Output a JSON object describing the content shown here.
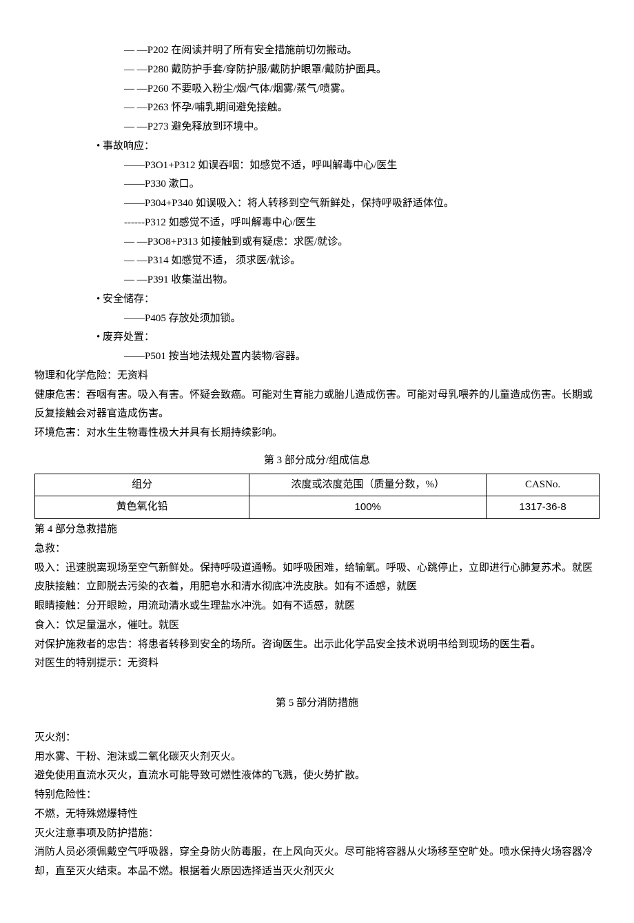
{
  "prevention": [
    "—        —P202 在阅读并明了所有安全措施前切勿搬动。",
    "—        —P280 戴防护手套/穿防护服/戴防护眼罩/戴防护面具。",
    "—        —P260 不要吸入粉尘/烟/气体/烟雾/蒸气/喷雾。",
    "—        —P263 怀孕/哺乳期间避免接触。",
    "—        —P273 避免释放到环境中。"
  ],
  "accident_label": "• 事故响应：",
  "accident": [
    "——P3O1+P312 如误吞咽：如感觉不适，呼叫解毒中心/医生",
    "——P330 漱口。",
    "——P304+P340 如误吸入：将人转移到空气新鲜处，保持呼吸舒适体位。",
    "------P312 如感觉不适，呼叫解毒中心/医生",
    "—        —P3O8+P313 如接触到或有疑虑：求医/就诊。",
    "—        —P314 如感觉不适， 须求医/就诊。",
    "—        —P391 收集溢出物。"
  ],
  "storage_label": "• 安全储存：",
  "storage_item": "——P405 存放处须加锁。",
  "disposal_label": "• 废弃处置：",
  "disposal_item": "——P501 按当地法规处置内装物/容器。",
  "phys_chem": "物理和化学危险：无资料",
  "health": "健康危害：吞咽有害。吸入有害。怀疑会致癌。可能对生育能力或胎儿造成伤害。可能对母乳喂养的儿童造成伤害。长期或反复接触会对器官造成伤害。",
  "env": "环境危害：对水生生物毒性极大并具有长期持续影响。",
  "section3_title": "第 3 部分成分/组成信息",
  "table": {
    "h1": "组分",
    "h2": "浓度或浓度范围（质量分数，%）",
    "h3": "CASNo.",
    "r1c1": "黄色氧化铅",
    "r1c2": "100%",
    "r1c3": "1317-36-8"
  },
  "section4_title": "第 4 部分急救措施",
  "s4_lines": [
    "急救：",
    "吸入：迅速脱离现场至空气新鲜处。保持呼吸道通畅。如呼吸困难，给输氧。呼吸、心跳停止，立即进行心肺复苏术。就医",
    "皮肤接触：立即脱去污染的衣着，用肥皂水和清水彻底冲洗皮肤。如有不适感，就医",
    "眼睛接触：分开眼睑，用流动清水或生理盐水冲洗。如有不适感，就医",
    "食入：饮足量温水，催吐。就医",
    "对保护施救者的忠告：将患者转移到安全的场所。咨询医生。出示此化学品安全技术说明书给到现场的医生看。",
    "对医生的特别提示：无资料"
  ],
  "section5_title": "第 5 部分消防措施",
  "s5_lines": [
    "灭火剂：",
    "用水雾、干粉、泡沫或二氧化碳灭火剂灭火。",
    "避免使用直流水灭火，直流水可能导致可燃性液体的飞溅，使火势扩散。",
    "特别危险性：",
    "不燃，无特殊燃爆特性",
    "灭火注意事项及防护措施：",
    "消防人员必须佩戴空气呼吸器，穿全身防火防毒服，在上风向灭火。尽可能将容器从火场移至空旷处。喷水保持火场容器冷却，直至灭火结束。本品不燃。根据着火原因选择适当灭火剂灭火"
  ]
}
